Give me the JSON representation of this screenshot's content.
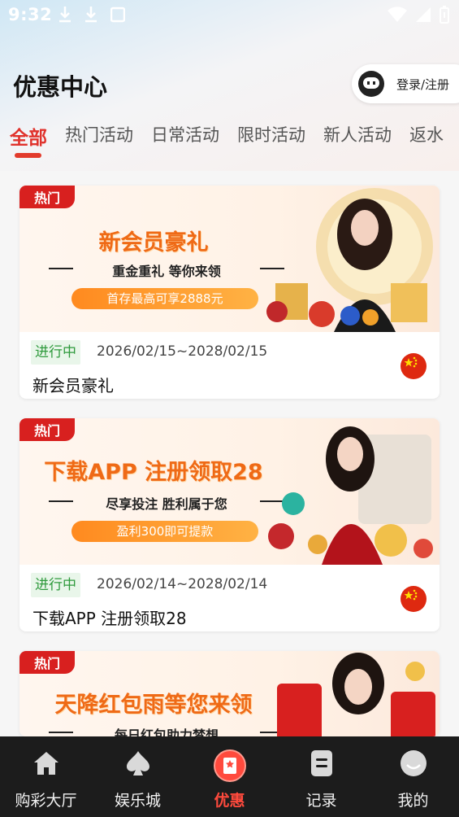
{
  "status_bar": {
    "time": "9:32"
  },
  "header": {
    "title": "优惠中心",
    "login_label": "登录/注册"
  },
  "tabs": [
    "全部",
    "热门活动",
    "日常活动",
    "限时活动",
    "新人活动",
    "返水"
  ],
  "promotions": [
    {
      "tag": "热门",
      "banner_title": "新会员豪礼",
      "banner_subtitle": "重金重礼 等你来领",
      "banner_pill": "首存最高可享2888元",
      "status": "进行中",
      "date_range": "2026/02/15~2028/02/15",
      "name": "新会员豪礼"
    },
    {
      "tag": "热门",
      "banner_title": "下载APP 注册领取28",
      "banner_subtitle": "尽享投注 胜利属于您",
      "banner_pill": "盈利300即可提款",
      "status": "进行中",
      "date_range": "2026/02/14~2028/02/14",
      "name": "下载APP 注册领取28"
    },
    {
      "tag": "热门",
      "banner_title": "天降红包雨等您来领",
      "banner_subtitle": "每日红包助力梦想"
    }
  ],
  "bottom_nav": [
    {
      "label": "购彩大厅",
      "icon": "home-icon"
    },
    {
      "label": "娱乐城",
      "icon": "spade-icon"
    },
    {
      "label": "优惠",
      "icon": "gift-icon",
      "active": true
    },
    {
      "label": "记录",
      "icon": "document-icon"
    },
    {
      "label": "我的",
      "icon": "profile-icon"
    }
  ],
  "colors": {
    "accent": "#e0322c",
    "hot_tag": "#d8201f",
    "status_green": "#2e9a3c",
    "nav_bg": "#1c1c1c"
  }
}
